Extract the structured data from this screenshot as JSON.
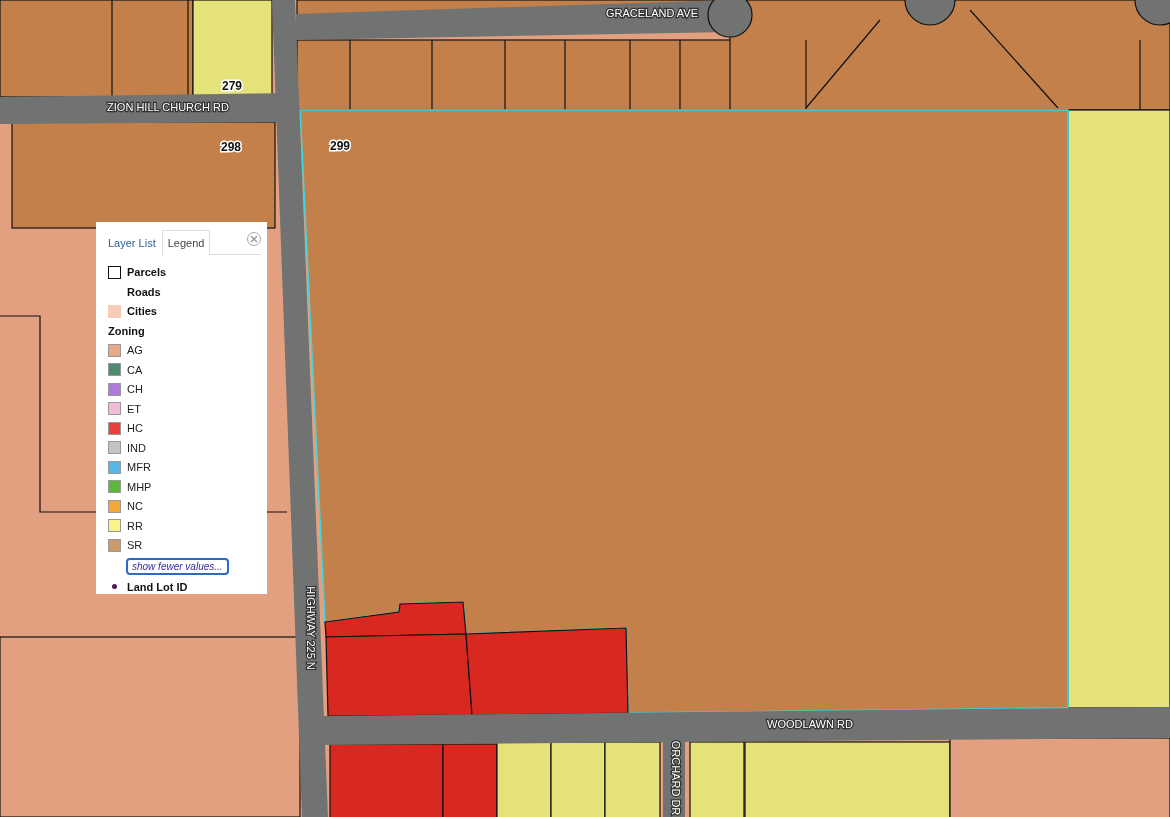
{
  "map": {
    "road_labels": [
      {
        "text": "GRACELAND AVE",
        "kind": "horizontal"
      },
      {
        "text": "ZION HILL CHURCH RD",
        "kind": "horizontal"
      },
      {
        "text": "HIGHWAY 225 N",
        "kind": "vertical"
      },
      {
        "text": "WOODLAWN RD",
        "kind": "horizontal"
      },
      {
        "text": "ORCHARD DR",
        "kind": "vertical"
      }
    ],
    "lot_labels": [
      {
        "text": "279"
      },
      {
        "text": "298"
      },
      {
        "text": "299"
      }
    ]
  },
  "panel": {
    "tabs": [
      {
        "label": "Layer List",
        "selected": false
      },
      {
        "label": "Legend",
        "selected": true
      }
    ],
    "layers": [
      {
        "kind": "outline",
        "label": "Parcels"
      },
      {
        "kind": "none",
        "label": "Roads"
      },
      {
        "kind": "fill",
        "label": "Cities",
        "color": "#f8cbb8"
      },
      {
        "kind": "group",
        "label": "Zoning",
        "items": [
          {
            "label": "AG",
            "color": "#e6a98a"
          },
          {
            "label": "CA",
            "color": "#4a8c70"
          },
          {
            "label": "CH",
            "color": "#b07ad8"
          },
          {
            "label": "ET",
            "color": "#f0bcd8"
          },
          {
            "label": "HC",
            "color": "#e8403d"
          },
          {
            "label": "IND",
            "color": "#c4c4c4"
          },
          {
            "label": "MFR",
            "color": "#56b8e8"
          },
          {
            "label": "MHP",
            "color": "#5cb83a"
          },
          {
            "label": "NC",
            "color": "#f5a638"
          },
          {
            "label": "RR",
            "color": "#f8f48a"
          },
          {
            "label": "SR",
            "color": "#d09a68"
          }
        ],
        "toggle": "show fewer values..."
      },
      {
        "kind": "dot",
        "label": "Land Lot ID",
        "color": "#4a1a50"
      }
    ]
  }
}
